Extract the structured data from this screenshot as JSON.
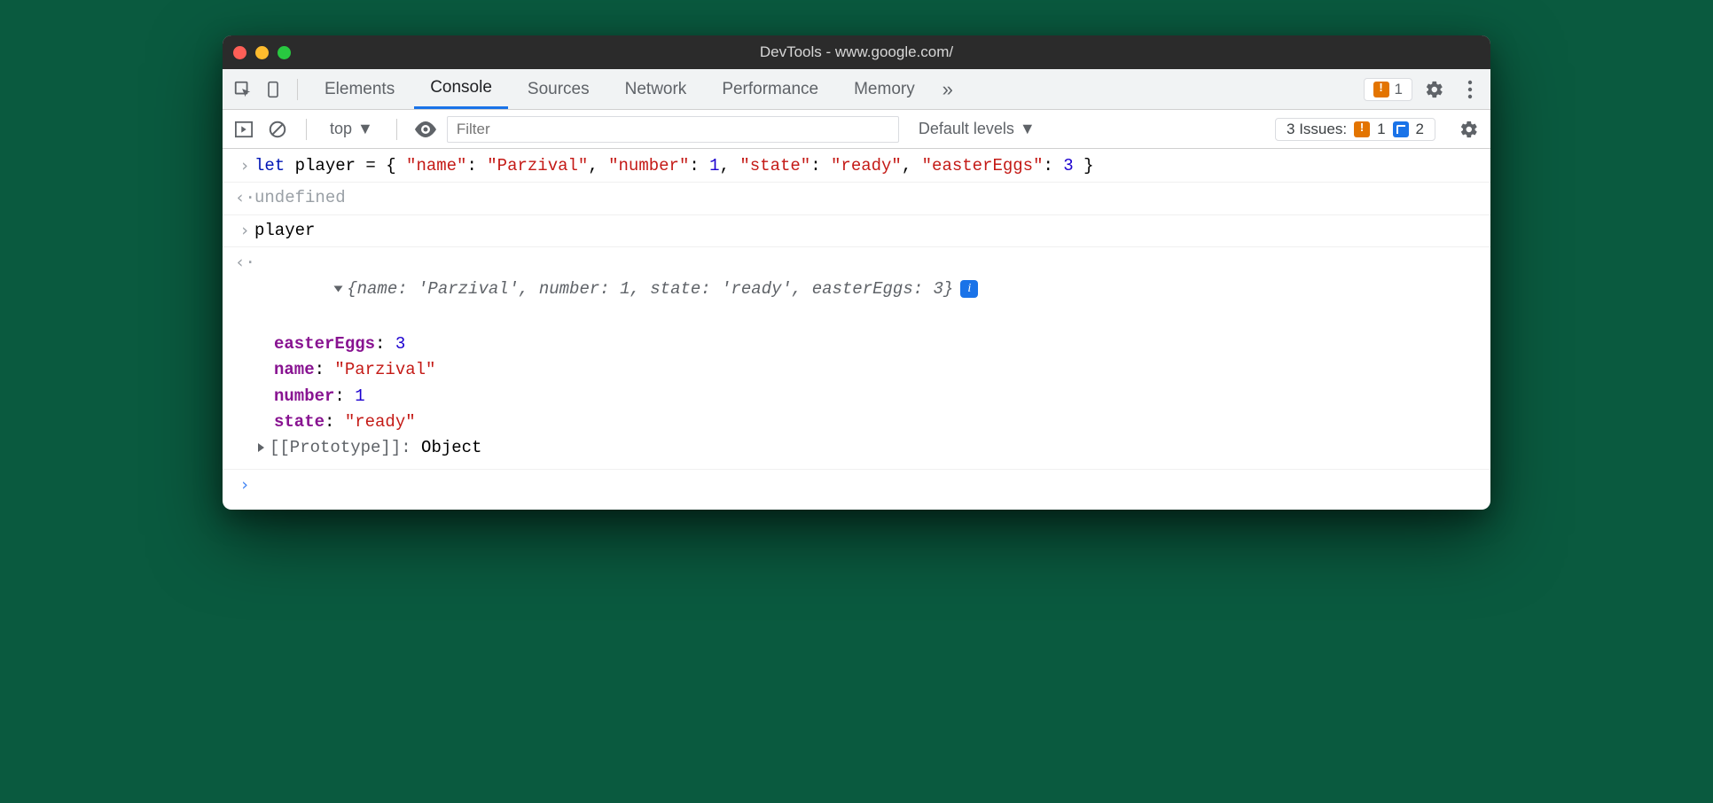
{
  "window": {
    "title": "DevTools - www.google.com/"
  },
  "tabs": {
    "items": [
      "Elements",
      "Console",
      "Sources",
      "Network",
      "Performance",
      "Memory"
    ],
    "active_index": 1
  },
  "warn_badge": {
    "count": "1"
  },
  "toolbar2": {
    "context": "top",
    "filter_placeholder": "Filter",
    "levels": "Default levels",
    "issues_label": "3 Issues:",
    "issues_warn": "1",
    "issues_info": "2"
  },
  "log": {
    "line1_prefix": "let ",
    "line1_var": "player",
    "line1_eq": " = { ",
    "k_name": "\"name\"",
    "v_name": "\"Parzival\"",
    "k_number": "\"number\"",
    "v_number": "1",
    "k_state": "\"state\"",
    "v_state": "\"ready\"",
    "k_eggs": "\"easterEggs\"",
    "v_eggs": "3",
    "line1_close": " }",
    "undef": "undefined",
    "line2": "player",
    "summary": "{name: 'Parzival', number: 1, state: 'ready', easterEggs: 3}",
    "prop_eggs_k": "easterEggs",
    "prop_eggs_v": "3",
    "prop_name_k": "name",
    "prop_name_v": "\"Parzival\"",
    "prop_number_k": "number",
    "prop_number_v": "1",
    "prop_state_k": "state",
    "prop_state_v": "\"ready\"",
    "proto_label": "[[Prototype]]",
    "proto_val": "Object"
  },
  "sep": {
    "colon_sp": ": ",
    "comma_sp": ", "
  }
}
